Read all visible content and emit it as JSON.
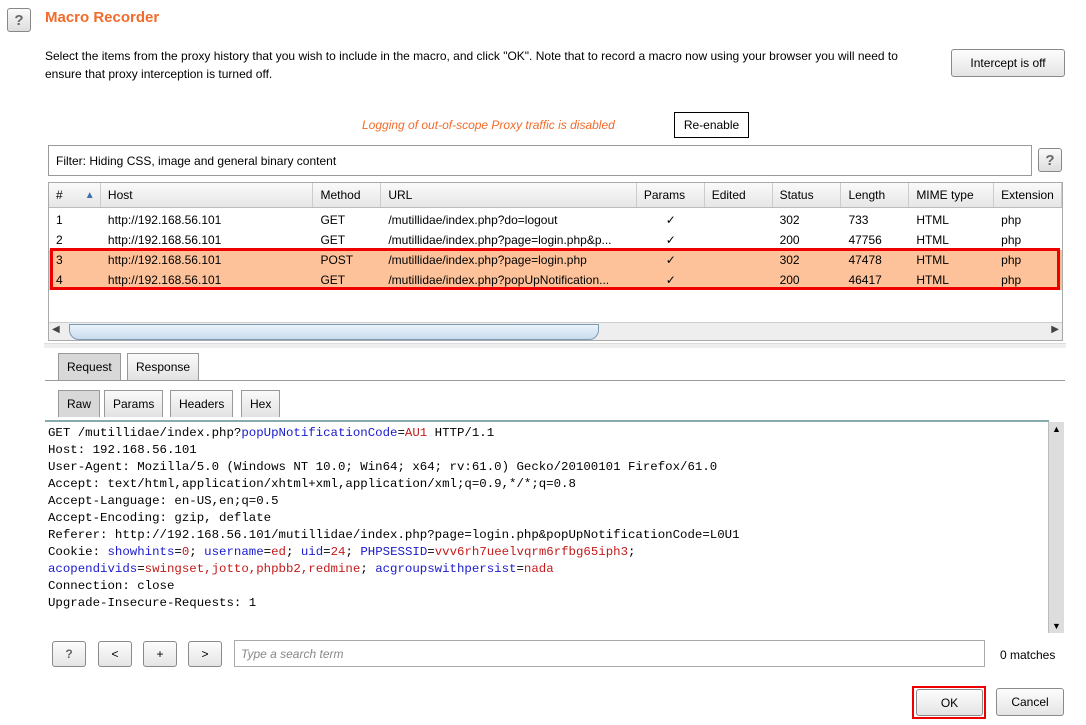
{
  "header": {
    "title": "Macro Recorder",
    "help_label": "?",
    "description": "Select the items from the proxy history that you wish to include in the macro, and click \"OK\". Note that to record a macro now using your browser you will need to ensure that proxy interception is turned off.",
    "intercept_label": "Intercept is off"
  },
  "logging": {
    "message": "Logging of out-of-scope Proxy traffic is disabled",
    "reenable_label": "Re-enable"
  },
  "filter": {
    "text": "Filter: Hiding CSS, image and general binary content",
    "help_label": "?"
  },
  "table": {
    "columns": [
      "#",
      "Host",
      "Method",
      "URL",
      "Params",
      "Edited",
      "Status",
      "Length",
      "MIME type",
      "Extension"
    ],
    "sort_indicator": "▲",
    "rows": [
      {
        "num": "1",
        "host": "http://192.168.56.101",
        "method": "GET",
        "url": "/mutillidae/index.php?do=logout",
        "params": "✓",
        "edited": "",
        "status": "302",
        "length": "733",
        "mime": "HTML",
        "ext": "php",
        "selected": false
      },
      {
        "num": "2",
        "host": "http://192.168.56.101",
        "method": "GET",
        "url": "/mutillidae/index.php?page=login.php&p...",
        "params": "✓",
        "edited": "",
        "status": "200",
        "length": "47756",
        "mime": "HTML",
        "ext": "php",
        "selected": false
      },
      {
        "num": "3",
        "host": "http://192.168.56.101",
        "method": "POST",
        "url": "/mutillidae/index.php?page=login.php",
        "params": "✓",
        "edited": "",
        "status": "302",
        "length": "47478",
        "mime": "HTML",
        "ext": "php",
        "selected": true
      },
      {
        "num": "4",
        "host": "http://192.168.56.101",
        "method": "GET",
        "url": "/mutillidae/index.php?popUpNotification...",
        "params": "✓",
        "edited": "",
        "status": "200",
        "length": "46417",
        "mime": "HTML",
        "ext": "php",
        "selected": true
      }
    ]
  },
  "tabs": {
    "main": [
      "Request",
      "Response"
    ],
    "sub": [
      "Raw",
      "Params",
      "Headers",
      "Hex"
    ]
  },
  "request_lines": [
    [
      [
        "p",
        "GET /mutillidae/index.php?"
      ],
      [
        "k",
        "popUpNotificationCode"
      ],
      [
        "p",
        "="
      ],
      [
        "v",
        "AU1"
      ],
      [
        "p",
        " HTTP/1.1"
      ]
    ],
    [
      [
        "p",
        "Host: 192.168.56.101"
      ]
    ],
    [
      [
        "p",
        "User-Agent: Mozilla/5.0 (Windows NT 10.0; Win64; x64; rv:61.0) Gecko/20100101 Firefox/61.0"
      ]
    ],
    [
      [
        "p",
        "Accept: text/html,application/xhtml+xml,application/xml;q=0.9,*/*;q=0.8"
      ]
    ],
    [
      [
        "p",
        "Accept-Language: en-US,en;q=0.5"
      ]
    ],
    [
      [
        "p",
        "Accept-Encoding: gzip, deflate"
      ]
    ],
    [
      [
        "p",
        "Referer: http://192.168.56.101/mutillidae/index.php?page=login.php&popUpNotificationCode=L0U1"
      ]
    ],
    [
      [
        "p",
        "Cookie: "
      ],
      [
        "k",
        "showhints"
      ],
      [
        "p",
        "="
      ],
      [
        "v",
        "0"
      ],
      [
        "p",
        "; "
      ],
      [
        "k",
        "username"
      ],
      [
        "p",
        "="
      ],
      [
        "v",
        "ed"
      ],
      [
        "p",
        "; "
      ],
      [
        "k",
        "uid"
      ],
      [
        "p",
        "="
      ],
      [
        "v",
        "24"
      ],
      [
        "p",
        "; "
      ],
      [
        "k",
        "PHPSESSID"
      ],
      [
        "p",
        "="
      ],
      [
        "v",
        "vvv6rh7ueelvqrm6rfbg65iph3"
      ],
      [
        "p",
        ";"
      ]
    ],
    [
      [
        "k",
        "acopendivids"
      ],
      [
        "p",
        "="
      ],
      [
        "v",
        "swingset,jotto,phpbb2,redmine"
      ],
      [
        "p",
        "; "
      ],
      [
        "k",
        "acgroupswithpersist"
      ],
      [
        "p",
        "="
      ],
      [
        "v",
        "nada"
      ]
    ],
    [
      [
        "p",
        "Connection: close"
      ]
    ],
    [
      [
        "p",
        "Upgrade-Insecure-Requests: 1"
      ]
    ]
  ],
  "search": {
    "help_label": "?",
    "prev_label": "<",
    "add_label": "+",
    "next_label": ">",
    "placeholder": "Type a search term",
    "matches": "0 matches"
  },
  "footer": {
    "ok_label": "OK",
    "cancel_label": "Cancel"
  }
}
